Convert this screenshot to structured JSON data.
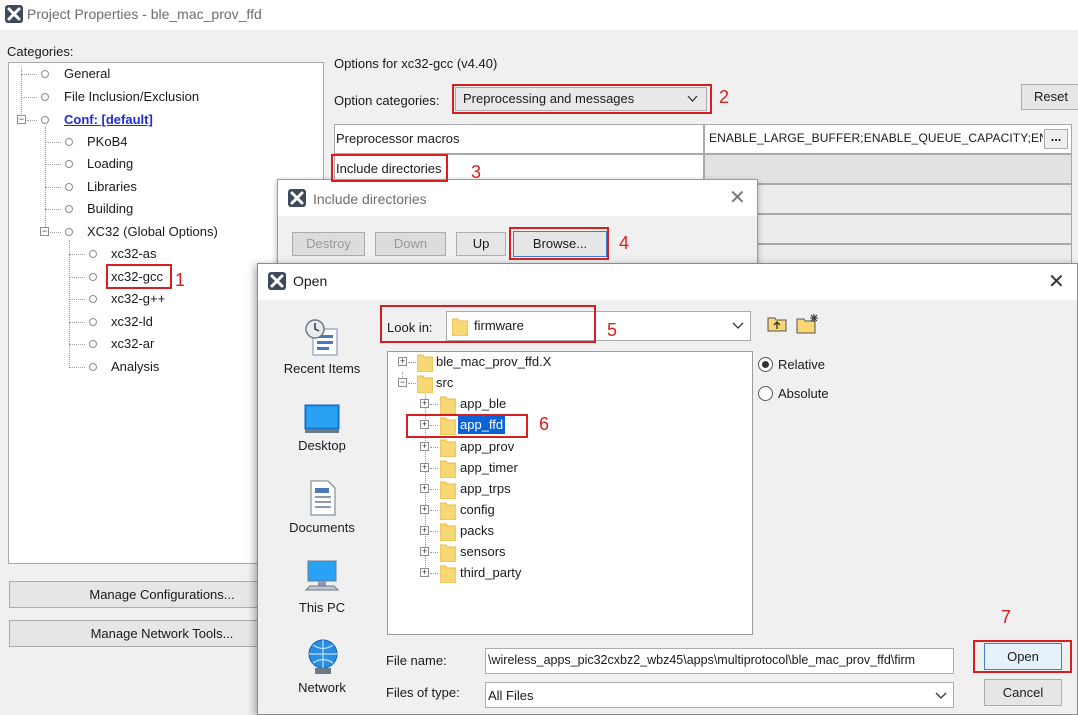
{
  "main_window": {
    "title": "Project Properties - ble_mac_prov_ffd",
    "categories_label": "Categories:",
    "categories": [
      "General",
      "File Inclusion/Exclusion",
      "Conf: [default]",
      "PKoB4",
      "Loading",
      "Libraries",
      "Building",
      "XC32 (Global Options)",
      "xc32-as",
      "xc32-gcc",
      "xc32-g++",
      "xc32-ld",
      "xc32-ar",
      "Analysis"
    ],
    "manage_configurations_label": "Manage Configurations...",
    "manage_network_tools_label": "Manage Network Tools..."
  },
  "options": {
    "options_for": "Options for xc32-gcc (v4.40)",
    "option_categories_label": "Option categories:",
    "option_categories_value": "Preprocessing and messages",
    "reset_label": "Reset",
    "rows": [
      {
        "label": "Preprocessor macros",
        "value": "ENABLE_LARGE_BUFFER;ENABLE_QUEUE_CAPACITY;EN"
      },
      {
        "label": "Include directories",
        "value": ""
      }
    ],
    "ellipsis_label": "..."
  },
  "include_dialog": {
    "title": "Include directories",
    "destroy_label": "Destroy",
    "down_label": "Down",
    "up_label": "Up",
    "browse_label": "Browse..."
  },
  "open_dialog": {
    "title": "Open",
    "places": [
      "Recent Items",
      "Desktop",
      "Documents",
      "This PC",
      "Network"
    ],
    "look_in_label": "Look in:",
    "look_in_value": "firmware",
    "tree": {
      "root_folder": "ble_mac_prov_ffd.X",
      "src_folder": "src",
      "src_children": [
        "app_ble",
        "app_ffd",
        "app_prov",
        "app_timer",
        "app_trps",
        "config",
        "packs",
        "sensors",
        "third_party"
      ]
    },
    "relative_label": "Relative",
    "absolute_label": "Absolute",
    "file_name_label": "File name:",
    "file_name_value": "\\wireless_apps_pic32cxbz2_wbz45\\apps\\multiprotocol\\ble_mac_prov_ffd\\firm",
    "files_of_type_label": "Files of type:",
    "files_of_type_value": "All Files",
    "open_label": "Open",
    "cancel_label": "Cancel"
  },
  "annotations": [
    "1",
    "2",
    "3",
    "4",
    "5",
    "6",
    "7"
  ],
  "colors": {
    "annotation_red": "#d62020",
    "selection_blue": "#0a64d8",
    "folder_yellow": "#f8d775",
    "conf_link_blue": "#1f2dd6"
  }
}
